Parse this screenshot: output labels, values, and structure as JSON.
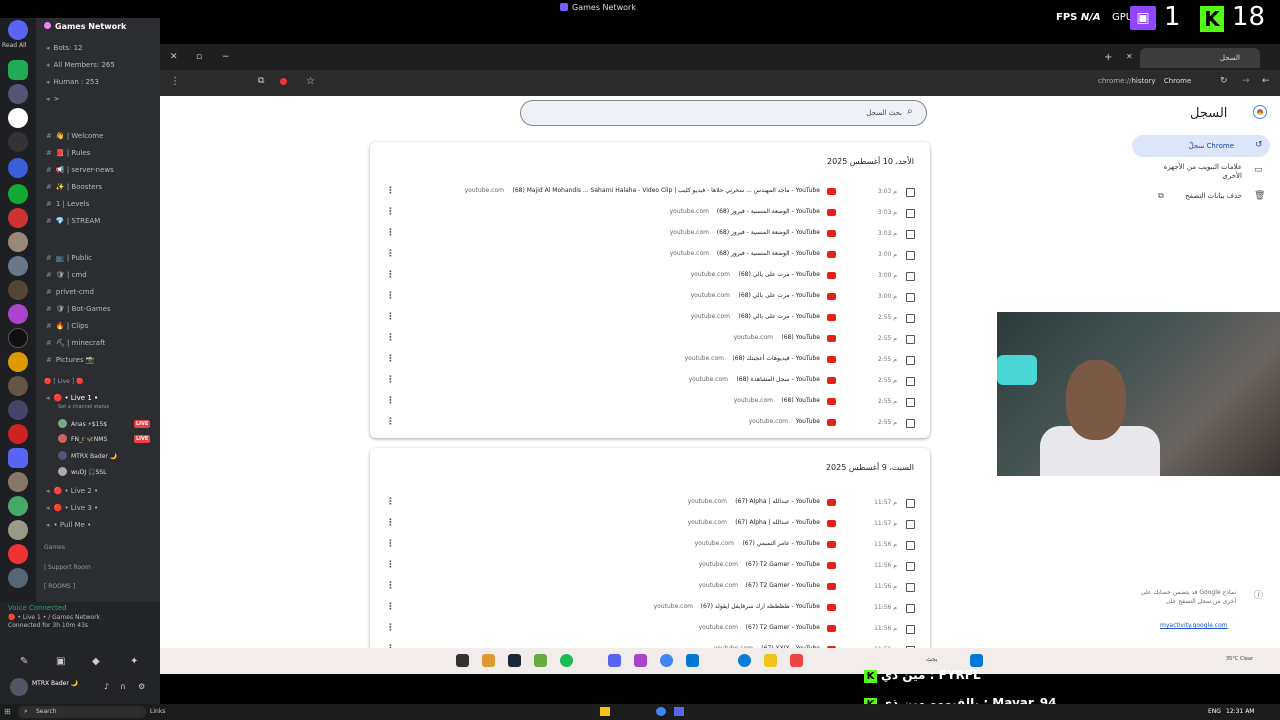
{
  "overlay": {
    "window_title": "Games Network",
    "fps_label": "FPS",
    "fps_value": "N/A",
    "gpu_label": "GPU",
    "count1": "1",
    "count2": "18"
  },
  "discord": {
    "read_all": "Read All",
    "server_name": "Games Network",
    "stats": [
      {
        "text": "Bots: 12"
      },
      {
        "text": "All Members: 265"
      },
      {
        "text": "Human : 253"
      },
      {
        "text": ">"
      }
    ],
    "channels": [
      {
        "text": "👋 | Welcome"
      },
      {
        "text": "📕 | Rules"
      },
      {
        "text": "📢 | server-news"
      },
      {
        "text": "✨ | Boosters"
      },
      {
        "text": "1 | Levels"
      },
      {
        "text": "💎 | STREAM"
      },
      {
        "text": "📺 | Public"
      },
      {
        "text": "🛡 | cmd"
      },
      {
        "text": "privet-cmd"
      },
      {
        "text": "🛡 | Bot-Games"
      },
      {
        "text": "🔥 | Clips"
      },
      {
        "text": "⛏ | minecraft"
      },
      {
        "text": "Pictures 📸"
      }
    ],
    "live_category": "🔴 [ Live ] 🔴",
    "live1": "🔴 • Live 1 •",
    "channel_status": "Set a channel status",
    "voice_users": [
      {
        "name": "Anas ⚡$15$",
        "live": true
      },
      {
        "name": "FN_r 🦋NMS",
        "live": true
      },
      {
        "name": "MTRX Bader 🌙",
        "live": false
      },
      {
        "name": "wuDJ 🎧SSL",
        "live": false
      }
    ],
    "more_voice": [
      "🔴 • Live 2 •",
      "🔴 • Live 3 •",
      "• Pull Me •"
    ],
    "cats": [
      "Games",
      "| Support Room",
      "[ ROOMS ]"
    ],
    "live_badge": "LIVE",
    "vc_title": "Voice Connected",
    "vc_sub": "🔴 • Live 1 • / Games Network",
    "vc_time": "Connected for 3h 10m 43s",
    "user_name": "MTRX Bader 🌙"
  },
  "browser": {
    "tab_label": "السجل",
    "url_prefix": "chrome://",
    "url_path": "history",
    "url_chip": "Chrome",
    "search_placeholder": "بحث السجل",
    "title": "السجل",
    "nav": [
      "سجلّ Chrome",
      "علامات التبويب من الأجهزة الأخرى",
      "حذف بيانات التصفح"
    ],
    "info_text": "قد يتضمن حسابك على Google نماذج أخرى من سجل التصفح على",
    "info_link": "myactivity.google.com"
  },
  "history": [
    {
      "date": "الأحد، 10 أغسطس 2025",
      "rows": [
        {
          "time": "3:03 م",
          "title": "(68) Majid Al Mohandis ... Saharni Halaha - Video Clip | ماجد المهندس ... سحرني حلاها - فيديو كليب - YouTube",
          "domain": "youtube.com"
        },
        {
          "time": "3:03 م",
          "title": "(68) الوضعة المنسية - فيروز - YouTube",
          "domain": "youtube.com"
        },
        {
          "time": "3:03 م",
          "title": "(68) الوضعة المنسية - فيروز - YouTube",
          "domain": "youtube.com"
        },
        {
          "time": "3:00 م",
          "title": "(68) الوضعة المنسية - فيروز - YouTube",
          "domain": "youtube.com"
        },
        {
          "time": "3:00 م",
          "title": "(68) مرت على بالي - YouTube",
          "domain": "youtube.com"
        },
        {
          "time": "3:00 م",
          "title": "(68) مرت على بالي - YouTube",
          "domain": "youtube.com"
        },
        {
          "time": "2:55 م",
          "title": "(68) مرت على بالي - YouTube",
          "domain": "youtube.com"
        },
        {
          "time": "2:55 م",
          "title": "(68) YouTube",
          "domain": "youtube.com"
        },
        {
          "time": "2:55 م",
          "title": "(68) فيديوهات أعجبتك - YouTube",
          "domain": "youtube.com"
        },
        {
          "time": "2:55 م",
          "title": "(68) سجل المشاهدة - YouTube",
          "domain": "youtube.com"
        },
        {
          "time": "2:55 م",
          "title": "(68) YouTube",
          "domain": "youtube.com"
        },
        {
          "time": "2:55 م",
          "title": "YouTube",
          "domain": "youtube.com"
        }
      ]
    },
    {
      "date": "السبت، 9 أغسطس 2025",
      "rows": [
        {
          "time": "11:57 م",
          "title": "(67) Alpha | عبدالله - YouTube",
          "domain": "youtube.com"
        },
        {
          "time": "11:57 م",
          "title": "(67) Alpha | عبدالله - YouTube",
          "domain": "youtube.com"
        },
        {
          "time": "11:56 م",
          "title": "(67) عامر التميمي - YouTube",
          "domain": "youtube.com"
        },
        {
          "time": "11:56 م",
          "title": "(67) T2 Gamer - YouTube",
          "domain": "youtube.com"
        },
        {
          "time": "11:56 م",
          "title": "(67) T2 Gamer - YouTube",
          "domain": "youtube.com"
        },
        {
          "time": "11:56 م",
          "title": "(67) ظظظظه ارك سرفايفل ايقولد - YouTube",
          "domain": "youtube.com"
        },
        {
          "time": "11:56 م",
          "title": "(67) T2 Gamer - YouTube",
          "domain": "youtube.com"
        },
        {
          "time": "11:56 م",
          "title": "(67) XXIX - YouTube",
          "domain": "youtube.com"
        }
      ]
    }
  ],
  "chat": [
    {
      "text": "مين ذي : FYRFL"
    },
    {
      "text": "يالقبووو مين ذي : Mayar_94"
    }
  ],
  "taskbar": {
    "inner_search": "بحث",
    "inner_time": "35°C Clear",
    "os_search": "Search",
    "links": "Links",
    "lang": "ENG",
    "time": "12:31 AM"
  },
  "colors": {
    "youtube_red": "#e62117",
    "discord_bg": "#2b2d31",
    "kick_green": "#53fc18",
    "twitch_purple": "#9146ff",
    "live_red": "#ed4245"
  }
}
